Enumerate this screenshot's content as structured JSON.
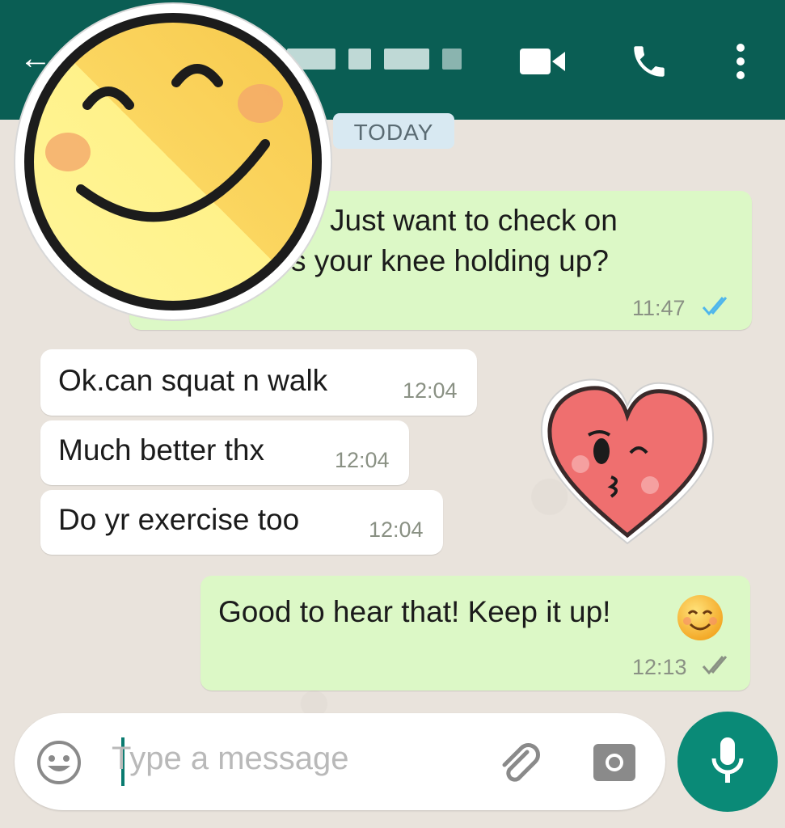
{
  "header": {
    "back_icon": "arrow-left-icon",
    "contact_name": "",
    "actions": [
      "video-call-icon",
      "phone-icon",
      "more-vert-icon"
    ],
    "color": "#0a5e54"
  },
  "date_chip": "TODAY",
  "messages": [
    {
      "direction": "outgoing",
      "lines": [
        "Just want to check on",
        "s your knee holding up?"
      ],
      "time": "11:47",
      "status": "read"
    },
    {
      "direction": "incoming",
      "text": "Ok.can squat n walk",
      "time": "12:04"
    },
    {
      "direction": "incoming",
      "text": "Much better thx",
      "time": "12:04"
    },
    {
      "direction": "incoming",
      "text": "Do yr exercise too",
      "time": "12:04"
    },
    {
      "direction": "outgoing",
      "text": "Good to hear that! Keep it up!",
      "emoji": "smiling-face-emoji",
      "time": "12:13",
      "status": "delivered"
    }
  ],
  "composer": {
    "placeholder": "Type a message",
    "icons": [
      "emoji-icon",
      "attach-icon",
      "camera-icon",
      "mic-icon"
    ]
  },
  "stickers": [
    "smiley-sticker",
    "kissing-heart-sticker"
  ],
  "colors": {
    "outgoing_bubble": "#dcf8c6",
    "incoming_bubble": "#ffffff",
    "accent": "#0a8a77",
    "read_tick": "#4fb6ec"
  }
}
